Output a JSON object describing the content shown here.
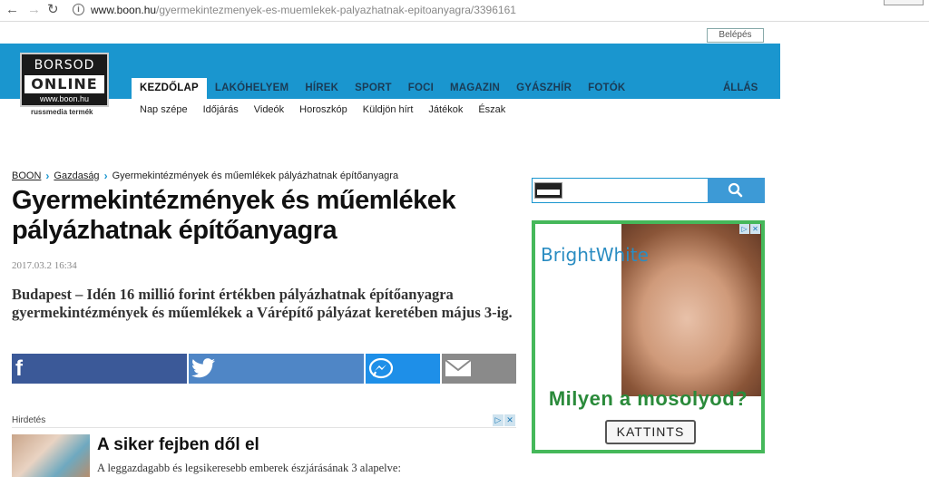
{
  "browser": {
    "back_icon": "arrow-left-icon",
    "url_host": "www.boon.hu",
    "url_path": "/gyermekintezmenyek-es-muemlekek-palyazhatnak-epitoanyagra/3396161"
  },
  "header": {
    "login_label": "Belépés",
    "logo": {
      "line1": "BORSOD",
      "line2": "ONLINE",
      "line3": "www.boon.hu"
    },
    "russ_label": "russmedia termék",
    "nav": [
      "KEZDŐLAP",
      "LAKÓHELYEM",
      "HÍREK",
      "SPORT",
      "FOCI",
      "MAGAZIN",
      "GYÁSZHÍR",
      "FOTÓK"
    ],
    "nav_right": "ÁLLÁS",
    "subnav": [
      "Nap szépe",
      "Időjárás",
      "Videók",
      "Horoszkóp",
      "Küldjön hírt",
      "Játékok",
      "Észak"
    ]
  },
  "article": {
    "breadcrumb": {
      "home": "BOON",
      "section": "Gazdaság",
      "current": "Gyermekintézmények és műemlékek pályázhatnak építőanyagra"
    },
    "title": "Gyermekintézmények és műemlékek pályázhatnak építőanyagra",
    "date": "2017.03.2 16:34",
    "lead": "Budapest – Idén 16 millió forint értékben pályázhatnak építőanyagra gyermekintézmények és műemlékek a Várépítő pályázat keretében május 3-ig.",
    "share": {
      "facebook_glyph": "f"
    }
  },
  "ad_bottom": {
    "label": "Hirdetés",
    "title": "A siker fejben dől el",
    "text": "A leggazdagabb és legsikeresebb emberek észjárásának 3 alapelve:"
  },
  "sidebar": {
    "search_placeholder": "",
    "ad": {
      "brand": "BrightWhite",
      "headline": "Milyen a mosolyod?",
      "cta": "KATTINTS"
    }
  },
  "colors": {
    "brand_blue": "#1a96cf",
    "facebook": "#3b5998",
    "twitter": "#4f86c6",
    "messenger": "#1e8fe8",
    "email": "#8a8a8a",
    "ad_green": "#45b85a"
  }
}
